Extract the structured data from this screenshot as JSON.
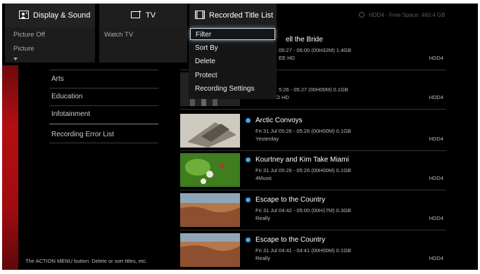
{
  "header": {
    "display_sound": "Display & Sound",
    "tv": "TV",
    "recorded": "Recorded Title List",
    "hdd_info": "HDD4 · Free Space: 460.4 GB"
  },
  "display_sound_menu": [
    "Picture Off",
    "Picture"
  ],
  "tv_menu": [
    "Watch TV"
  ],
  "genres": [
    "Arts",
    "Education",
    "Infotainment",
    "Recording Error List"
  ],
  "action_menu": [
    "Filter",
    "Sort By",
    "Delete",
    "Protect",
    "Recording Settings"
  ],
  "partial_rows": [
    {
      "title": "ell the Bride",
      "date": "05:27 - 06:00 (00H32M) 1.4GB",
      "channel": "EE HD",
      "hdd": "HDD4"
    },
    {
      "title": "",
      "date": "5:26 - 05:27 (00H00M) 0.1GB",
      "channel": "BBC TWO HD",
      "hdd": "HDD4"
    }
  ],
  "recordings": [
    {
      "title": "Arctic Convoys",
      "date": "Fri 31 Jul 05:26 - 05:26 (00H00M) 0.1GB",
      "channel": "Yesterday",
      "hdd": "HDD4"
    },
    {
      "title": "Kourtney and Kim Take Miami",
      "date": "Fri 31 Jul 05:26 - 05:26 (00H00M) 0.1GB",
      "channel": "4Music",
      "hdd": "HDD4"
    },
    {
      "title": "Escape to the Country",
      "date": "Fri 31 Jul 04:42 - 05:00 (00H17M) 0.3GB",
      "channel": "Really",
      "hdd": "HDD4"
    },
    {
      "title": "Escape to the Country",
      "date": "Fri 31 Jul 04:41 - 04:41 (00H00M) 0.1GB",
      "channel": "Really",
      "hdd": "HDD4"
    }
  ],
  "footer": "The ACTION MENU button: Delete or sort titles, etc.",
  "colors": {
    "accent_red": "#b30f12",
    "new_dot": "#4aa3e0"
  }
}
